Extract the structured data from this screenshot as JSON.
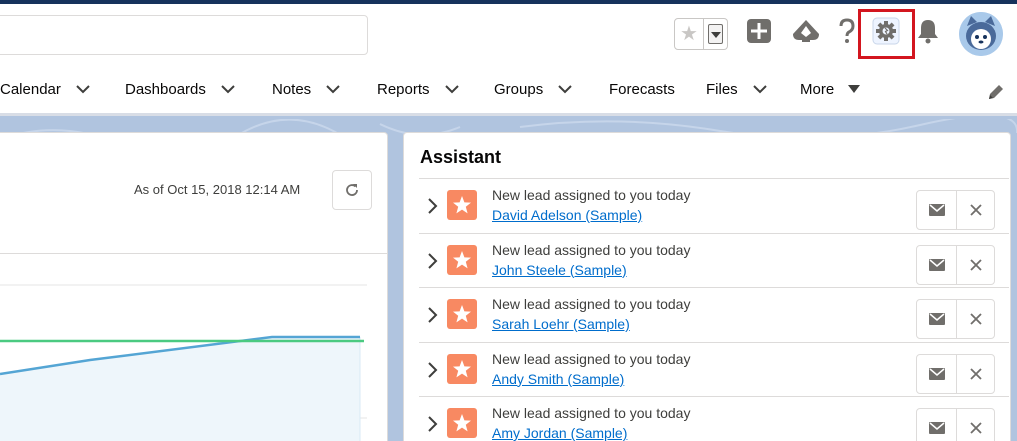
{
  "header": {
    "search": {
      "placeholder": ""
    },
    "icons": [
      "favorites-star-icon",
      "add-icon",
      "trailhead-icon",
      "help-icon",
      "setup-gear-icon",
      "notification-bell-icon",
      "user-avatar"
    ]
  },
  "nav": {
    "items": [
      {
        "label": "Calendar",
        "has_chevron": true
      },
      {
        "label": "Dashboards",
        "has_chevron": true
      },
      {
        "label": "Notes",
        "has_chevron": true
      },
      {
        "label": "Reports",
        "has_chevron": true
      },
      {
        "label": "Groups",
        "has_chevron": true
      },
      {
        "label": "Forecasts",
        "has_chevron": false
      },
      {
        "label": "Files",
        "has_chevron": true
      }
    ],
    "more_label": "More"
  },
  "performance": {
    "as_of": "As of Oct 15, 2018 12:14 AM"
  },
  "assistant": {
    "title": "Assistant",
    "items": [
      {
        "message": "New lead assigned to you today",
        "name": "David Adelson (Sample)"
      },
      {
        "message": "New lead assigned to you today",
        "name": "John Steele (Sample)"
      },
      {
        "message": "New lead assigned to you today",
        "name": "Sarah Loehr (Sample)"
      },
      {
        "message": "New lead assigned to you today",
        "name": "Andy Smith (Sample)"
      },
      {
        "message": "New lead assigned to you today",
        "name": "Amy Jordan (Sample)"
      }
    ]
  },
  "colors": {
    "brand_dark": "#16325c",
    "highlight_red": "#d3161f",
    "lead_icon": "#f88962",
    "link": "#006dcc",
    "chart_green": "#4bca81",
    "chart_blue": "#54a5d4"
  }
}
